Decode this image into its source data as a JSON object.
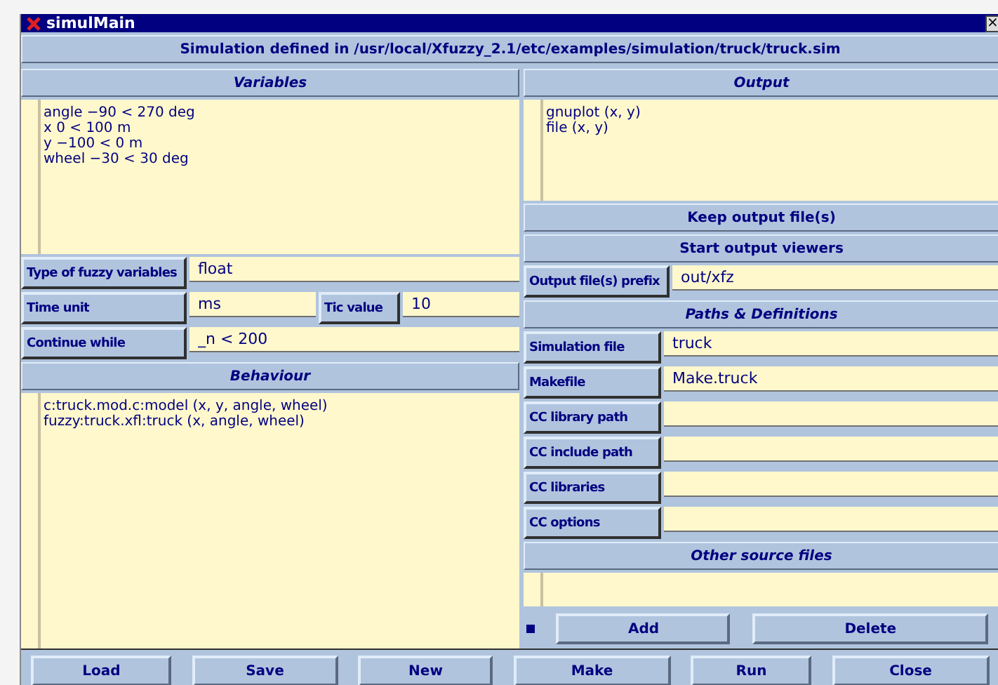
{
  "window": {
    "title": "simulMain",
    "close": "×"
  },
  "header": "Simulation defined in /usr/local/Xfuzzy_2.1/etc/examples/simulation/truck/truck.sim",
  "variables": {
    "title": "Variables",
    "lines": [
      "angle −90 < 270 deg",
      "x 0 < 100 m",
      "y −100 < 0 m",
      "wheel −30 < 30 deg"
    ]
  },
  "left_fields": [
    {
      "label": "Type of fuzzy variables",
      "value": "float"
    },
    {
      "label": "Time unit",
      "value": "ms",
      "extra_label": "Tic value",
      "extra_value": "10"
    },
    {
      "label": "Continue while",
      "value": "_n < 200"
    }
  ],
  "behaviour": {
    "title": "Behaviour",
    "lines": [
      "c:truck.mod.c:model (x, y, angle, wheel)",
      "fuzzy:truck.xfl:truck (x, angle, wheel)"
    ]
  },
  "output": {
    "title": "Output",
    "lines": [
      "gnuplot (x, y)",
      "file (x, y)"
    ]
  },
  "output_buttons": [
    "Keep output file(s)",
    "Start output viewers"
  ],
  "prefix": {
    "label": "Output file(s) prefix",
    "value": "out/xfz"
  },
  "paths": {
    "title": "Paths & Definitions",
    "fields": [
      {
        "label": "Simulation file",
        "value": "truck"
      },
      {
        "label": "Makefile",
        "value": "Make.truck"
      },
      {
        "label": "CC library path"
      },
      {
        "label": "CC include path"
      },
      {
        "label": "CC libraries"
      },
      {
        "label": "CC options"
      }
    ]
  },
  "other_sources": {
    "title": "Other source files",
    "buttons": [
      "Add",
      "Delete"
    ]
  },
  "bottom_buttons": [
    "Load",
    "Save",
    "New",
    "Make",
    "Run",
    "Close"
  ]
}
